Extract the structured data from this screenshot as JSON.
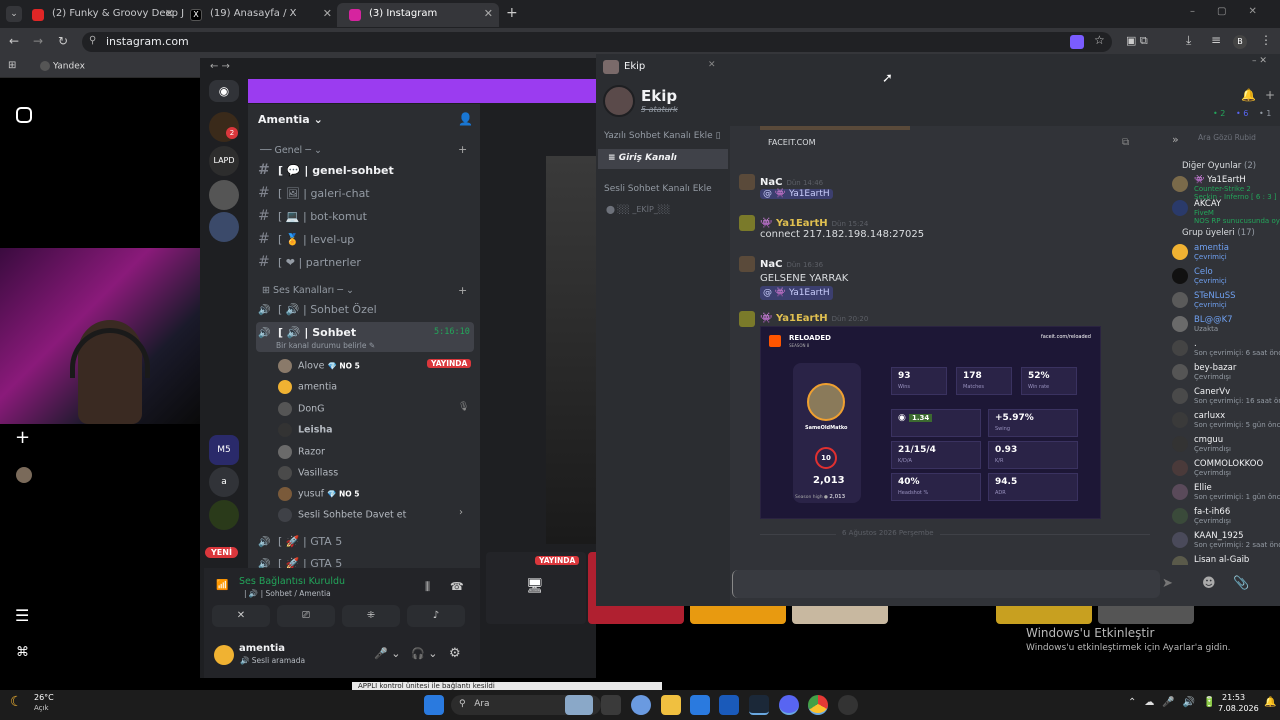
{
  "browser": {
    "tabs": [
      {
        "title": "(2) Funky & Groovy Deep J",
        "color": "#e02626"
      },
      {
        "title": "(19) Anasayfa / X",
        "color": "#000000"
      },
      {
        "title": "(3) Instagram",
        "color": "#d6249f"
      }
    ],
    "url": "instagram.com",
    "bookmark": "Yandex",
    "profile_initial": "B"
  },
  "discord": {
    "server_name": "Amentia",
    "server_labels": {
      "lapd": "LAPD",
      "m5": "M5",
      "a": "a",
      "new_badge": "YENİ",
      "notif_count": "2"
    },
    "categories": {
      "general": "Genel",
      "voice": "Ses Kanalları"
    },
    "text_channels": [
      {
        "name": "genel-sohbet",
        "active": true
      },
      {
        "name": "galeri-chat"
      },
      {
        "name": "bot-komut"
      },
      {
        "name": "level-up"
      },
      {
        "name": "partnerler"
      }
    ],
    "voice_channels": {
      "private": "Sohbet Özel",
      "active": "Sohbet",
      "active_time": "5:16:10",
      "status": "Bir kanal durumu belirle",
      "users": [
        {
          "name": "Alove",
          "badge": "NO 5",
          "live": "YAYINDA"
        },
        {
          "name": "amentia"
        },
        {
          "name": "DonG"
        },
        {
          "name": "Leisha"
        },
        {
          "name": "Razor"
        },
        {
          "name": "Vasillass"
        },
        {
          "name": "yusuf",
          "badge": "NO 5"
        }
      ],
      "invite": "Sesli Sohbete Davet et",
      "gta1": "GTA 5",
      "gta2": "GTA 5"
    },
    "connection": {
      "status": "Ses Bağlantısı Kuruldu",
      "channel": "Sohbet / Amentia"
    },
    "user": {
      "name": "amentia",
      "status": "Sesli aramada"
    },
    "live_badge": "YAYINDA"
  },
  "overlay": {
    "window_title": "Ekip",
    "group_name": "Ekip",
    "group_sub": "5 ataturk",
    "sidebar": {
      "add_text": "Yazılı Sohbet Kanalı Ekle",
      "entry": "Giriş Kanalı",
      "add_voice": "Sesli Sohbet Kanalı Ekle",
      "voice_item": "EKİP"
    },
    "embed_link": "FACEIT.COM",
    "messages": [
      {
        "author": "NaC",
        "time": "Dün 14:46",
        "mention": "Ya1EartH"
      },
      {
        "author": "Ya1EartH",
        "time": "Dün 15:24",
        "text": "connect 217.182.198.148:27025"
      },
      {
        "author": "NaC",
        "time": "Dün 16:36",
        "text": "GELSENE YARRAK",
        "mention": "Ya1EartH"
      },
      {
        "author": "Ya1EartH",
        "time": "Dün 20:20"
      }
    ],
    "date_divider": "6 Ağustos 2026 Perşembe",
    "counts": {
      "a": "2",
      "b": "6",
      "c": "1"
    },
    "search_placeholder": "Ara Gözü Rubid",
    "card": {
      "title": "RELOADED",
      "subtitle": "SEASON 8",
      "link": "faceit.com/reloaded",
      "player": "SameOldMatko",
      "level": "10",
      "elo": "2,013",
      "season_high_label": "Season high",
      "season_high": "2,013",
      "stats": [
        {
          "value": "93",
          "label": "Wins"
        },
        {
          "value": "178",
          "label": "Matches"
        },
        {
          "value": "52%",
          "label": "Win rate"
        },
        {
          "value": "1.34",
          "label": ""
        },
        {
          "value": "+5.97%",
          "label": "Swing"
        },
        {
          "value": "21/15/4",
          "label": "K/D/A"
        },
        {
          "value": "0.93",
          "label": "K/R"
        },
        {
          "value": "40%",
          "label": "Headshot %"
        },
        {
          "value": "94.5",
          "label": "ADR"
        }
      ]
    },
    "members": {
      "section_games": "Diğer Oyunlar",
      "games_count": "(2)",
      "games": [
        {
          "name": "Ya1EartH",
          "status": "Counter-Strike 2",
          "sub": "Seçkin - Inferno [ 6 : 3 ]"
        },
        {
          "name": "AKCAY",
          "status": "FiveM",
          "sub": "NOS RP sunucusunda oynuyor"
        }
      ],
      "section_group": "Grup üyeleri",
      "group_count": "(17)",
      "list": [
        {
          "name": "amentia",
          "status": "Çevrimiçi"
        },
        {
          "name": "Celo",
          "status": "Çevrimiçi"
        },
        {
          "name": "STeNLuSS",
          "status": "Çevrimiçi"
        },
        {
          "name": "BL@@K7",
          "status": "Uzakta"
        },
        {
          "name": ".",
          "status": "Son çevrimiçi: 6 saat önce"
        },
        {
          "name": "bey-bazar",
          "status": "Çevrimdışı"
        },
        {
          "name": "CanerVv",
          "status": "Son çevrimiçi: 16 saat önce"
        },
        {
          "name": "carluxx",
          "status": "Son çevrimiçi: 5 gün önce"
        },
        {
          "name": "cmguu",
          "status": "Çevrimdışı"
        },
        {
          "name": "COMMOLOKKOO",
          "status": "Çevrimdışı"
        },
        {
          "name": "Ellie",
          "status": "Son çevrimiçi: 1 gün önce"
        },
        {
          "name": "fa-t-ih66",
          "status": "Çevrimdışı"
        },
        {
          "name": "KAAN_1925",
          "status": "Son çevrimiçi: 2 saat önce"
        },
        {
          "name": "Lisan al-Gaib",
          "status": ""
        }
      ]
    }
  },
  "windows": {
    "activate_title": "Windows'u Etkinleştir",
    "activate_sub": "Windows'u etkinleştirmek için Ayarlar'a gidin."
  },
  "taskbar": {
    "weather_temp": "26°C",
    "weather_desc": "Açık",
    "search": "Ara",
    "time": "21:53",
    "date": "7.08.2026"
  },
  "bottom_text": "APPLI kontrol ünitesi ile bağlantı kesildi"
}
